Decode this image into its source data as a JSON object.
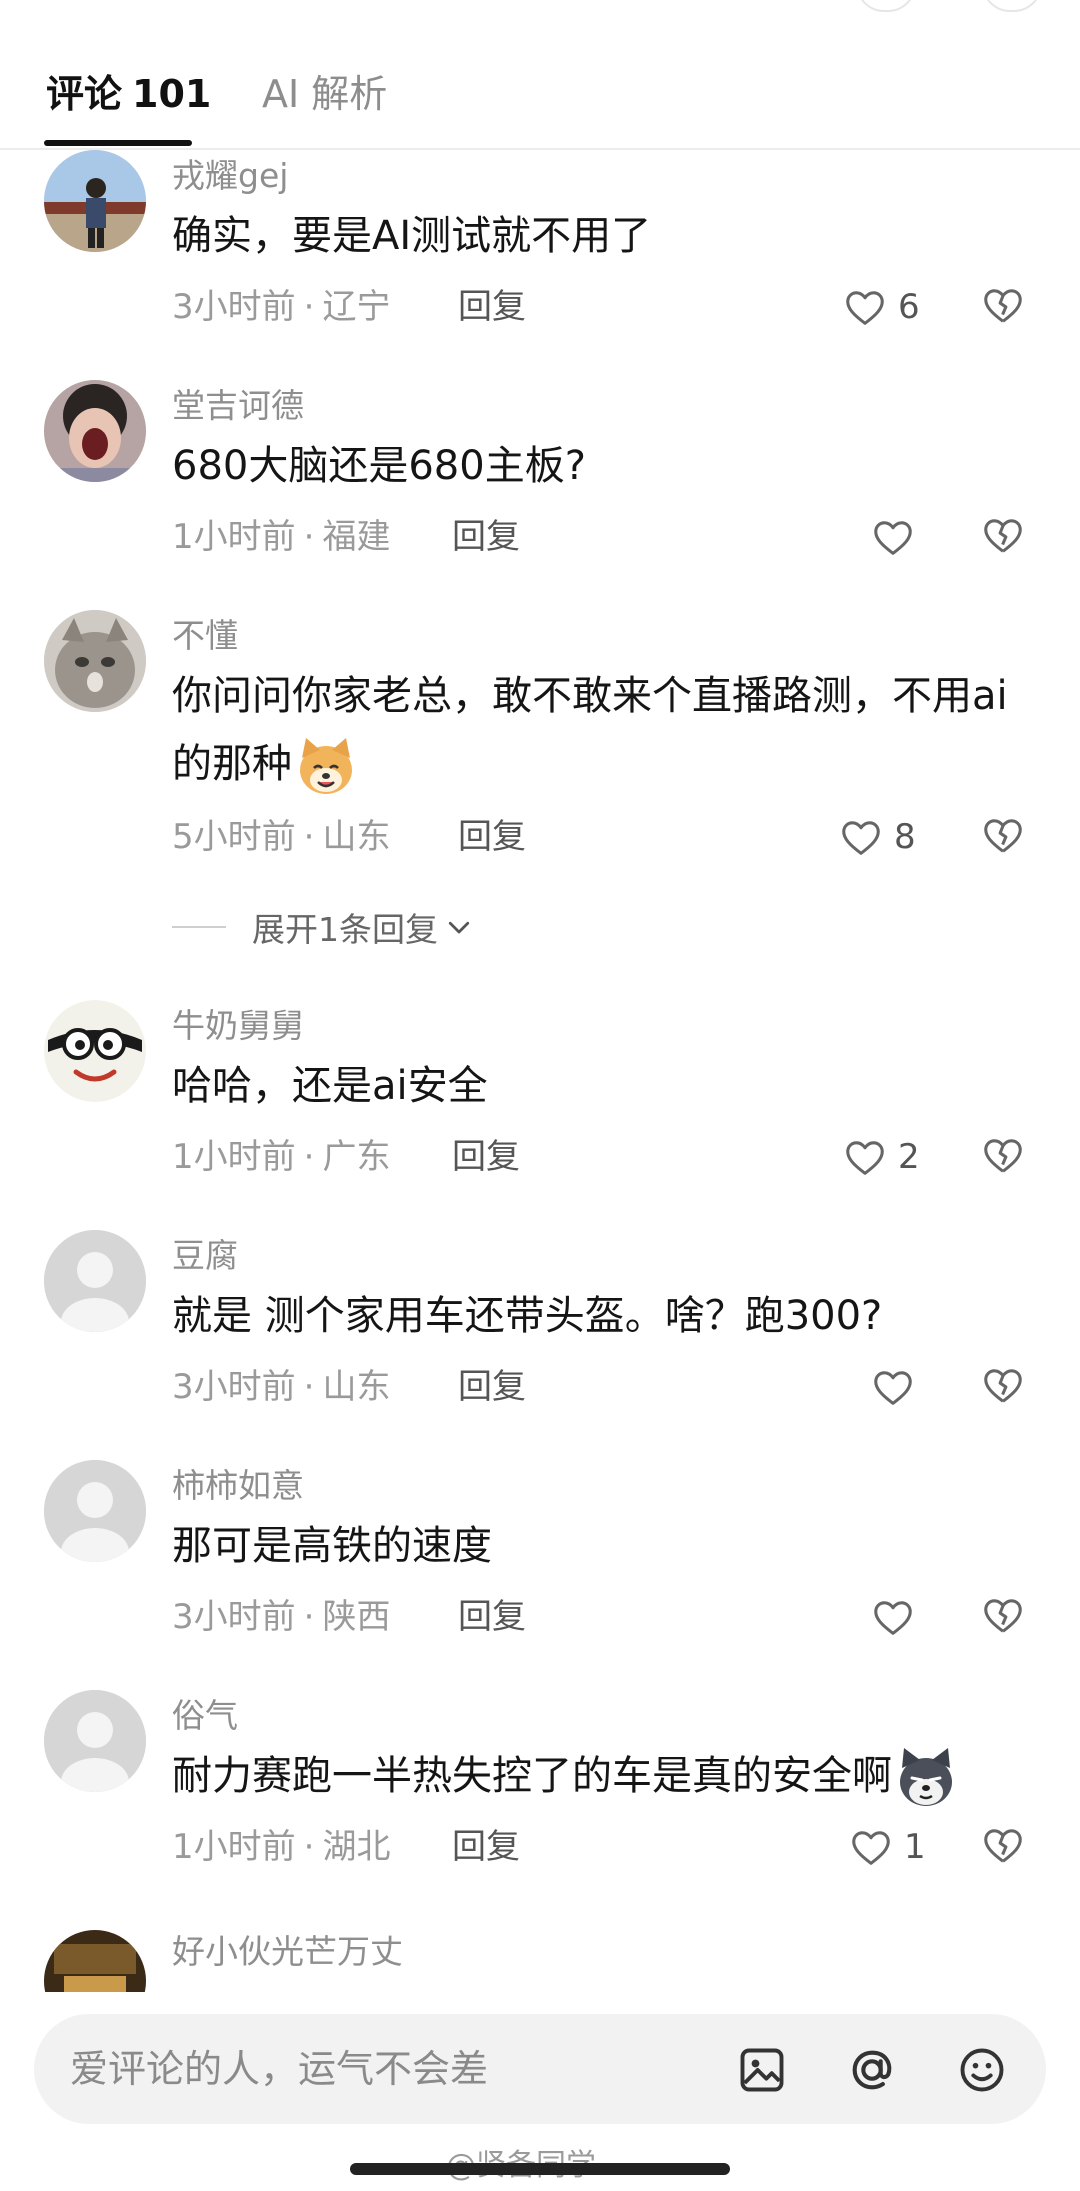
{
  "tabs": {
    "comments_label": "评论",
    "comments_count": "101",
    "ai_label": "AI 解析"
  },
  "comments": [
    {
      "user": "戎耀gej",
      "text": "确实，要是AI测试就不用了",
      "time": "3小时前",
      "location": "辽宁",
      "reply": "回复",
      "likes": "6"
    },
    {
      "user": "堂吉诃德",
      "text": "680大脑还是680主板?",
      "time": "1小时前",
      "location": "福建",
      "reply": "回复",
      "likes": ""
    },
    {
      "user": "不懂",
      "text": "你问问你家老总，敢不敢来个直播路测，不用ai的那种",
      "time": "5小时前",
      "location": "山东",
      "reply": "回复",
      "likes": "8"
    },
    {
      "user": "牛奶舅舅",
      "text": "哈哈，还是ai安全",
      "time": "1小时前",
      "location": "广东",
      "reply": "回复",
      "likes": "2"
    },
    {
      "user": "豆腐",
      "text": "就是 测个家用车还带头盔。啥？跑300?",
      "time": "3小时前",
      "location": "山东",
      "reply": "回复",
      "likes": ""
    },
    {
      "user": "柿柿如意",
      "text": "那可是高铁的速度",
      "time": "3小时前",
      "location": "陕西",
      "reply": "回复",
      "likes": ""
    },
    {
      "user": "俗气",
      "text": "耐力赛跑一半热失控了的车是真的安全啊",
      "time": "1小时前",
      "location": "湖北",
      "reply": "回复",
      "likes": "1"
    },
    {
      "user": "好小伙光芒万丈"
    }
  ],
  "expand_replies": "展开1条回复",
  "input": {
    "placeholder": "爱评论的人，运气不会差",
    "icons": [
      "image-icon",
      "at-icon",
      "emoji-icon"
    ]
  },
  "watermark": "@贤备同学",
  "colors": {
    "text_primary": "#151515",
    "text_secondary": "#9a9a9a",
    "input_bg": "#f2f2f2"
  }
}
